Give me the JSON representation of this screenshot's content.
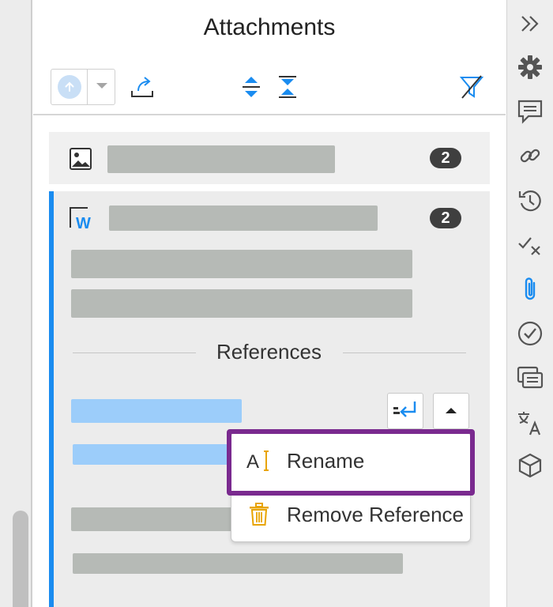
{
  "panel": {
    "title": "Attachments"
  },
  "toolbar": {
    "upload_icon": "upload-arrow-icon",
    "dropdown_icon": "chevron-down-icon",
    "export_icon": "export-icon",
    "expand_all_icon": "expand-all-icon",
    "collapse_all_icon": "collapse-all-icon",
    "filter_icon": "filter-off-icon"
  },
  "attachments": [
    {
      "icon": "image-file-icon",
      "count": "2"
    },
    {
      "icon": "word-file-icon",
      "file_badge": "W",
      "count": "2"
    }
  ],
  "references": {
    "title": "References"
  },
  "context_menu": {
    "items": [
      {
        "label": "Rename",
        "icon": "rename-icon",
        "highlighted": true
      },
      {
        "label": "Remove Reference",
        "icon": "trash-icon"
      }
    ]
  },
  "rail": {
    "icons": [
      "collapse-panel-icon",
      "settings-icon",
      "comments-icon",
      "link-icon",
      "history-icon",
      "review-icon",
      "attachments-icon",
      "approve-icon",
      "compare-icon",
      "translate-icon",
      "3d-model-icon"
    ],
    "active": "attachments-icon"
  },
  "colors": {
    "accent": "#1a8cf0",
    "highlight": "#7a2a8f",
    "placeholder_gray": "#b6bab6",
    "placeholder_blue": "#9ccdfa",
    "trash": "#e8a400"
  }
}
